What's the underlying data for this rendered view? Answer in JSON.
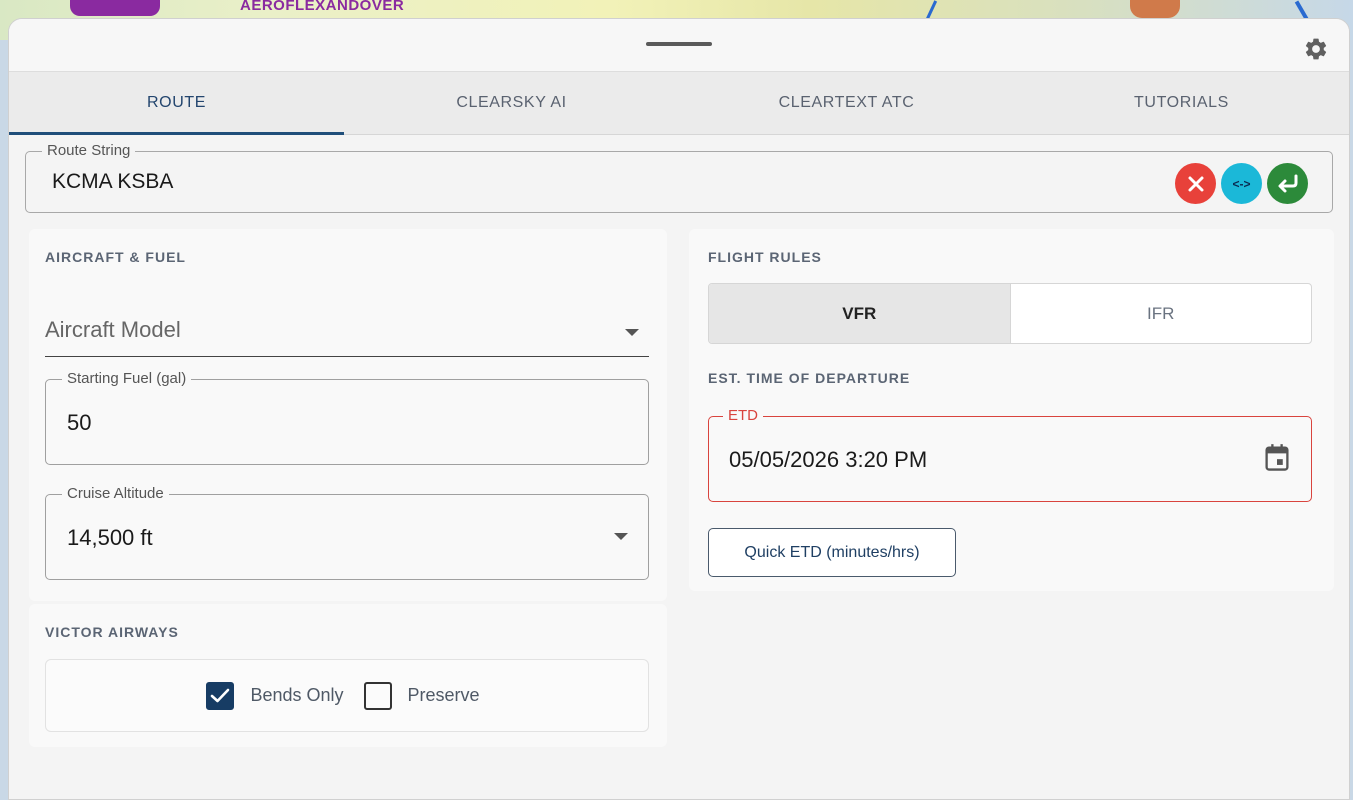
{
  "map": {
    "label": "AEROFLEXANDOVER"
  },
  "header": {
    "settings_icon": "gear-icon"
  },
  "tabs": [
    {
      "label": "ROUTE",
      "active": true
    },
    {
      "label": "CLEARSKY AI",
      "active": false
    },
    {
      "label": "CLEARTEXT ATC",
      "active": false
    },
    {
      "label": "TUTORIALS",
      "active": false
    }
  ],
  "route": {
    "label": "Route String",
    "value": "KCMA KSBA",
    "swap_label": "<->",
    "clear_icon": "close-icon",
    "enter_icon": "enter-arrow-icon"
  },
  "aircraft": {
    "title": "AIRCRAFT & FUEL",
    "model_placeholder": "Aircraft Model",
    "fuel_label": "Starting Fuel (gal)",
    "fuel_value": "50",
    "altitude_label": "Cruise Altitude",
    "altitude_value": "14,500 ft"
  },
  "victor": {
    "title": "VICTOR AIRWAYS",
    "options": [
      {
        "label": "Bends Only",
        "checked": true
      },
      {
        "label": "Preserve",
        "checked": false
      }
    ]
  },
  "flight": {
    "rules_title": "FLIGHT RULES",
    "rules": [
      {
        "label": "VFR",
        "active": true
      },
      {
        "label": "IFR",
        "active": false
      }
    ],
    "etd_title": "EST. TIME OF DEPARTURE",
    "etd_label": "ETD",
    "etd_value": "05/05/2026 3:20 PM",
    "quick_label": "Quick ETD (minutes/hrs)"
  },
  "colors": {
    "accent": "#1f4e7a",
    "error": "#d9443e",
    "clear_button": "#e8413a",
    "swap_button": "#1bb8d8",
    "enter_button": "#2c8a3a"
  }
}
